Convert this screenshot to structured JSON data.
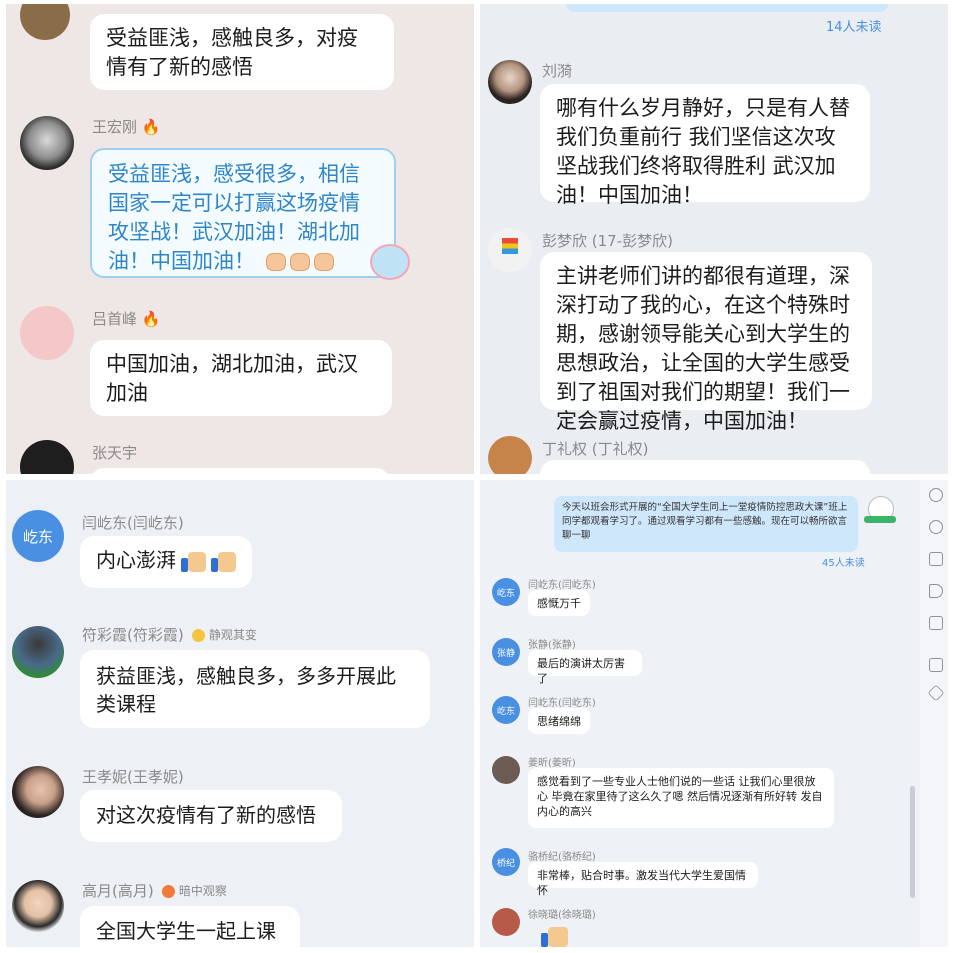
{
  "panel1": {
    "top_message": "受益匪浅，感触良多，对疫情有了新的感悟",
    "messages": [
      {
        "name": "王宏刚",
        "text": "受益匪浅，感受很多，相信国家一定可以打赢这场疫情攻坚战！武汉加油！湖北加油！中国加油！"
      },
      {
        "name": "吕首峰",
        "text": "中国加油，湖北加油，武汉加油"
      },
      {
        "name": "张天宇",
        "text": ""
      }
    ]
  },
  "panel2": {
    "unread": "14人未读",
    "messages": [
      {
        "name": "刘漪",
        "text": "哪有什么岁月静好，只是有人替我们负重前行 我们坚信这次攻坚战我们终将取得胜利 武汉加油！中国加油！"
      },
      {
        "name": "彭梦欣 (17-彭梦欣)",
        "text": "主讲老师们讲的都很有道理，深深打动了我的心，在这个特殊时期，感谢领导能关心到大学生的思想政治，让全国的大学生感受到了祖国对我们的期望！我们一定会赢过疫情，中国加油！"
      },
      {
        "name": "丁礼权 (丁礼权)",
        "text": ""
      }
    ]
  },
  "panel3": {
    "messages": [
      {
        "name": "闫屹东(闫屹东)",
        "avatar": "屹东",
        "tag": "",
        "text": "内心澎湃"
      },
      {
        "name": "符彩霞(符彩霞)",
        "tag": "静观其变",
        "text": "获益匪浅，感触良多，多多开展此类课程"
      },
      {
        "name": "王孝妮(王孝妮)",
        "tag": "",
        "text": "对这次疫情有了新的感悟"
      },
      {
        "name": "高月(高月)",
        "tag": "暗中观察",
        "text": "全国大学生一起上课"
      }
    ]
  },
  "panel4": {
    "announcement": "今天以班会形式开展的“全国大学生同上一堂疫情防控思政大课”班上同学都观看学习了。通过观看学习都有一些感触。现在可以畅所欲言聊一聊",
    "unread": "45人未读",
    "messages": [
      {
        "name": "闫屹东(闫屹东)",
        "avatar": "屹东",
        "text": "感慨万千"
      },
      {
        "name": "张静(张静)",
        "avatar": "张静",
        "text": "最后的演讲太厉害了"
      },
      {
        "name": "闫屹东(闫屹东)",
        "avatar": "屹东",
        "text": "思绪绵绵"
      },
      {
        "name": "姜昕(姜昕)",
        "avatar": "",
        "text": "感觉看到了一些专业人士他们说的一些话 让我们心里很放心 毕竟在家里待了这么久了嗯 然后情况逐渐有所好转 发自内心的高兴"
      },
      {
        "name": "骆桥纪(骆桥纪)",
        "avatar": "桥纪",
        "text": "非常棒，贴合时事。激发当代大学生爱国情怀"
      },
      {
        "name": "徐晓璐(徐晓璐)",
        "avatar": "",
        "text": ""
      }
    ],
    "side_icons": [
      "add-user-icon",
      "clock-icon",
      "folder-icon",
      "megaphone-icon",
      "tv-icon",
      "add-box-icon",
      "cube-icon"
    ]
  },
  "colors": {
    "accent_blue": "#4a90e2",
    "highlight_border": "#9fd0f0",
    "highlight_text": "#2e86c8"
  }
}
